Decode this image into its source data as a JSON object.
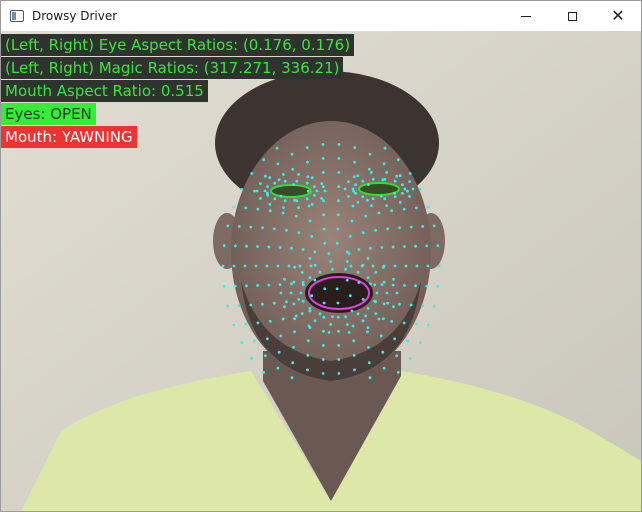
{
  "window": {
    "title": "Drowsy Driver",
    "controls": {
      "minimize": "minimize",
      "maximize": "maximize",
      "close": "✕"
    }
  },
  "overlay": {
    "eye_aspect": "(Left, Right) Eye Aspect Ratios: (0.176, 0.176)",
    "magic_ratios": "(Left, Right) Magic Ratios: (317.271, 336.21)",
    "mouth_aspect": "Mouth Aspect Ratio: 0.515",
    "eyes_status": "Eyes: OPEN",
    "mouth_status": "Mouth: YAWNING"
  },
  "colors": {
    "landmark": "#32f0f0",
    "eye_contour": "#2ee02e",
    "mouth_contour": "#e040e0",
    "status_ok": "#33ee33",
    "status_alert": "#ee3333"
  }
}
